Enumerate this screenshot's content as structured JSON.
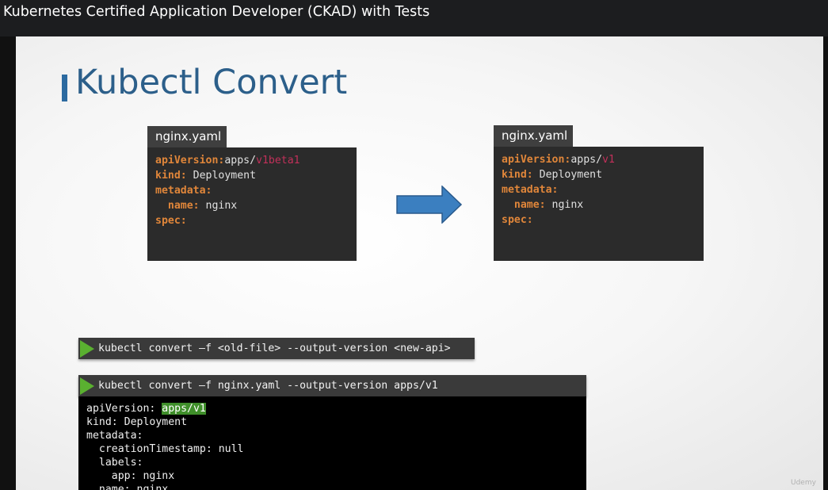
{
  "window": {
    "title": "Kubernetes Certified Application Developer (CKAD) with Tests"
  },
  "slide": {
    "title": "Kubectl Convert",
    "left_file": {
      "tab": "nginx.yaml",
      "api_key": "apiVersion:",
      "api_group": "apps/",
      "api_version": "v1beta1",
      "kind_key": "kind:",
      "kind_val": "Deployment",
      "metadata_key": "metadata:",
      "name_key": "name:",
      "name_val": "nginx",
      "spec_key": "spec:"
    },
    "right_file": {
      "tab": "nginx.yaml",
      "api_key": "apiVersion:",
      "api_group": "apps/",
      "api_version": "v1",
      "kind_key": "kind:",
      "kind_val": "Deployment",
      "metadata_key": "metadata:",
      "name_key": "name:",
      "name_val": "nginx",
      "spec_key": "spec:"
    },
    "arrow_icon": "right-arrow-icon",
    "command_generic": "kubectl convert –f <old-file> --output-version <new-api>",
    "command_example": "kubectl convert –f nginx.yaml --output-version apps/v1",
    "output": {
      "line1_key": "apiVersion: ",
      "line1_val": "apps/v1",
      "line2": "kind: Deployment",
      "line3": "metadata:",
      "line4": "  creationTimestamp: null",
      "line5": "  labels:",
      "line6": "    app: nginx",
      "line7": "  name: nginx"
    },
    "watermark": "Udemy"
  },
  "colors": {
    "accent": "#2c6aa0",
    "title": "#2c5f8a",
    "key": "#e0863a",
    "version": "#c2305a",
    "play": "#5ab030"
  }
}
